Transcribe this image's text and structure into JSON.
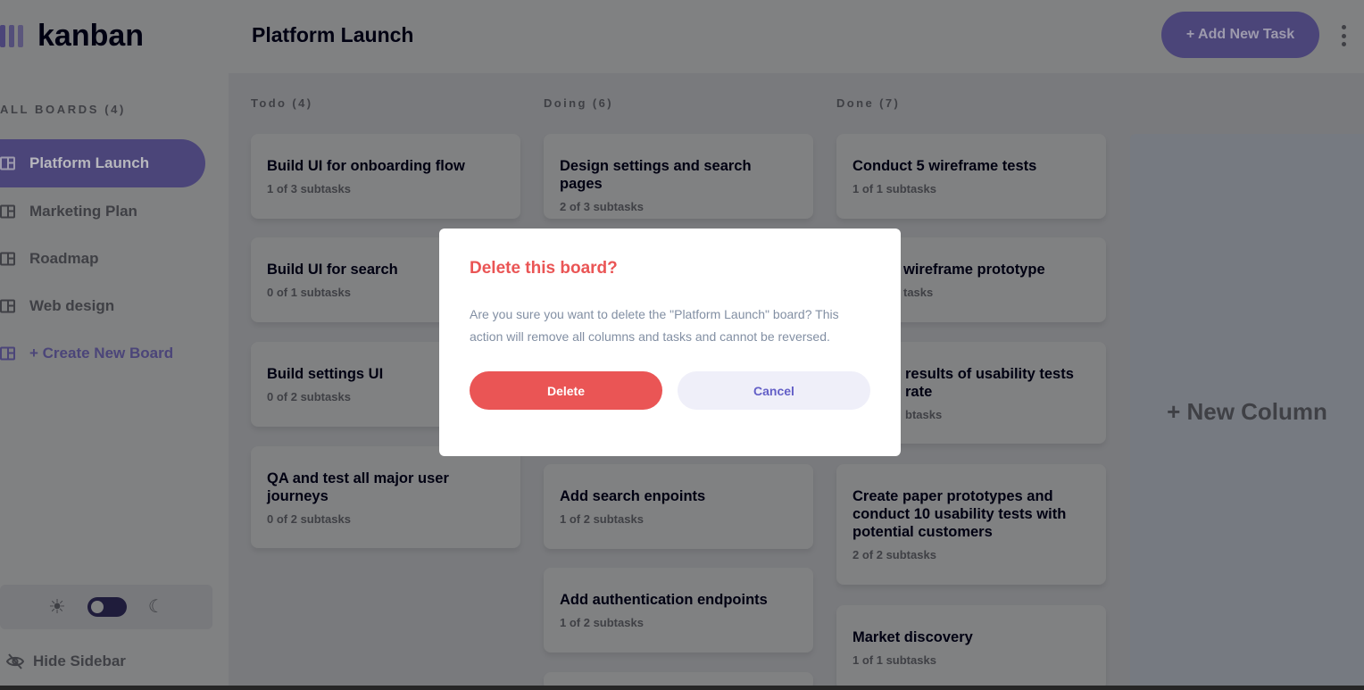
{
  "app": {
    "logo_text": "kanban"
  },
  "sidebar": {
    "all_boards_label": "ALL BOARDS (4)",
    "boards": [
      {
        "label": "Platform Launch",
        "active": true
      },
      {
        "label": "Marketing Plan",
        "active": false
      },
      {
        "label": "Roadmap",
        "active": false
      },
      {
        "label": "Web design",
        "active": false
      }
    ],
    "create_label": "+ Create New Board",
    "hide_label": "Hide Sidebar",
    "theme": {
      "light_icon": "sun-icon",
      "dark_icon": "moon-icon",
      "dark_mode_on": true
    }
  },
  "header": {
    "title": "Platform Launch",
    "add_task_label": "+ Add New Task"
  },
  "columns": [
    {
      "title": "Todo (4)",
      "tasks": [
        {
          "title": "Build UI for onboarding flow",
          "subtasks": "1 of 3 subtasks"
        },
        {
          "title": "Build UI for search",
          "subtasks": "0 of 1 subtasks"
        },
        {
          "title": "Build settings UI",
          "subtasks": "0 of 2 subtasks"
        },
        {
          "title": "QA and test all major user journeys",
          "subtasks": "0 of 2 subtasks"
        }
      ]
    },
    {
      "title": "Doing (6)",
      "tasks": [
        {
          "title": "Design settings and search pages",
          "subtasks": "2 of 3 subtasks"
        },
        {
          "title": "Add search enpoints",
          "subtasks": "1 of 2 subtasks"
        },
        {
          "title": "Add authentication endpoints",
          "subtasks": "1 of 2 subtasks"
        }
      ]
    },
    {
      "title": "Done (7)",
      "tasks": [
        {
          "title": "Conduct 5 wireframe tests",
          "subtasks": "1 of 1 subtasks"
        },
        {
          "title": "wireframe prototype",
          "subtasks": "tasks"
        },
        {
          "title": "results of usability tests",
          "title_line2": "rate",
          "subtasks": "btasks"
        },
        {
          "title": "Create paper prototypes and conduct 10 usability tests with potential customers",
          "subtasks": "2 of 2 subtasks"
        },
        {
          "title": "Market discovery",
          "subtasks": "1 of 1 subtasks"
        }
      ]
    }
  ],
  "new_column_label": "+ New Column",
  "modal": {
    "title": "Delete this board?",
    "text": "Are you sure you want to delete the \"Platform Launch\" board? This action will remove all columns and tasks and cannot be reversed.",
    "delete_label": "Delete",
    "cancel_label": "Cancel"
  },
  "colors": {
    "accent": "#635fc7",
    "danger": "#ea5555",
    "cancel_bg": "#efeff9",
    "muted_text": "#828fa3"
  }
}
